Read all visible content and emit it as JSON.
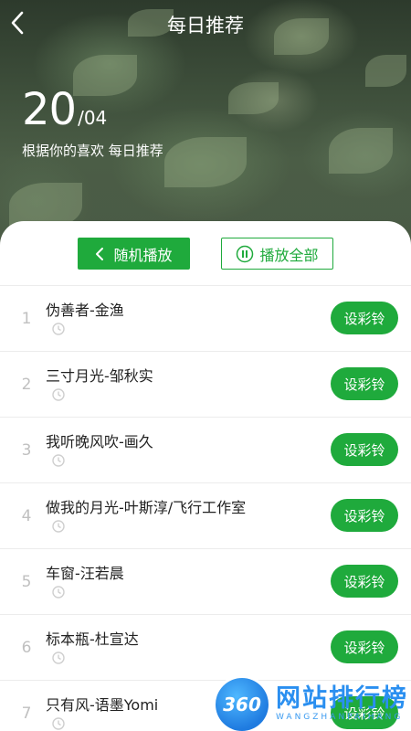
{
  "header": {
    "title": "每日推荐",
    "back_icon": "chevron-left-icon",
    "date_day": "20",
    "date_month": "/04",
    "subtitle": "根据你的喜欢 每日推荐"
  },
  "actions": {
    "random_label": "随机播放",
    "play_all_label": "播放全部"
  },
  "songs": [
    {
      "index": "1",
      "title": "伪善者-金渔",
      "button": "设彩铃"
    },
    {
      "index": "2",
      "title": "三寸月光-邹秋实",
      "button": "设彩铃"
    },
    {
      "index": "3",
      "title": "我听晚风吹-画久",
      "button": "设彩铃"
    },
    {
      "index": "4",
      "title": "做我的月光-叶斯淳/飞行工作室",
      "button": "设彩铃"
    },
    {
      "index": "5",
      "title": "车窗-汪若晨",
      "button": "设彩铃"
    },
    {
      "index": "6",
      "title": "标本瓶-杜宣达",
      "button": "设彩铃"
    },
    {
      "index": "7",
      "title": "只有风-语墨Yomi",
      "button": "设彩铃"
    }
  ],
  "watermark": {
    "badge": "360",
    "text": "网站排行榜",
    "sub": "WANGZHANPAIHANG"
  },
  "colors": {
    "accent": "#1faa3c",
    "index_gray": "#c0c0c0"
  }
}
